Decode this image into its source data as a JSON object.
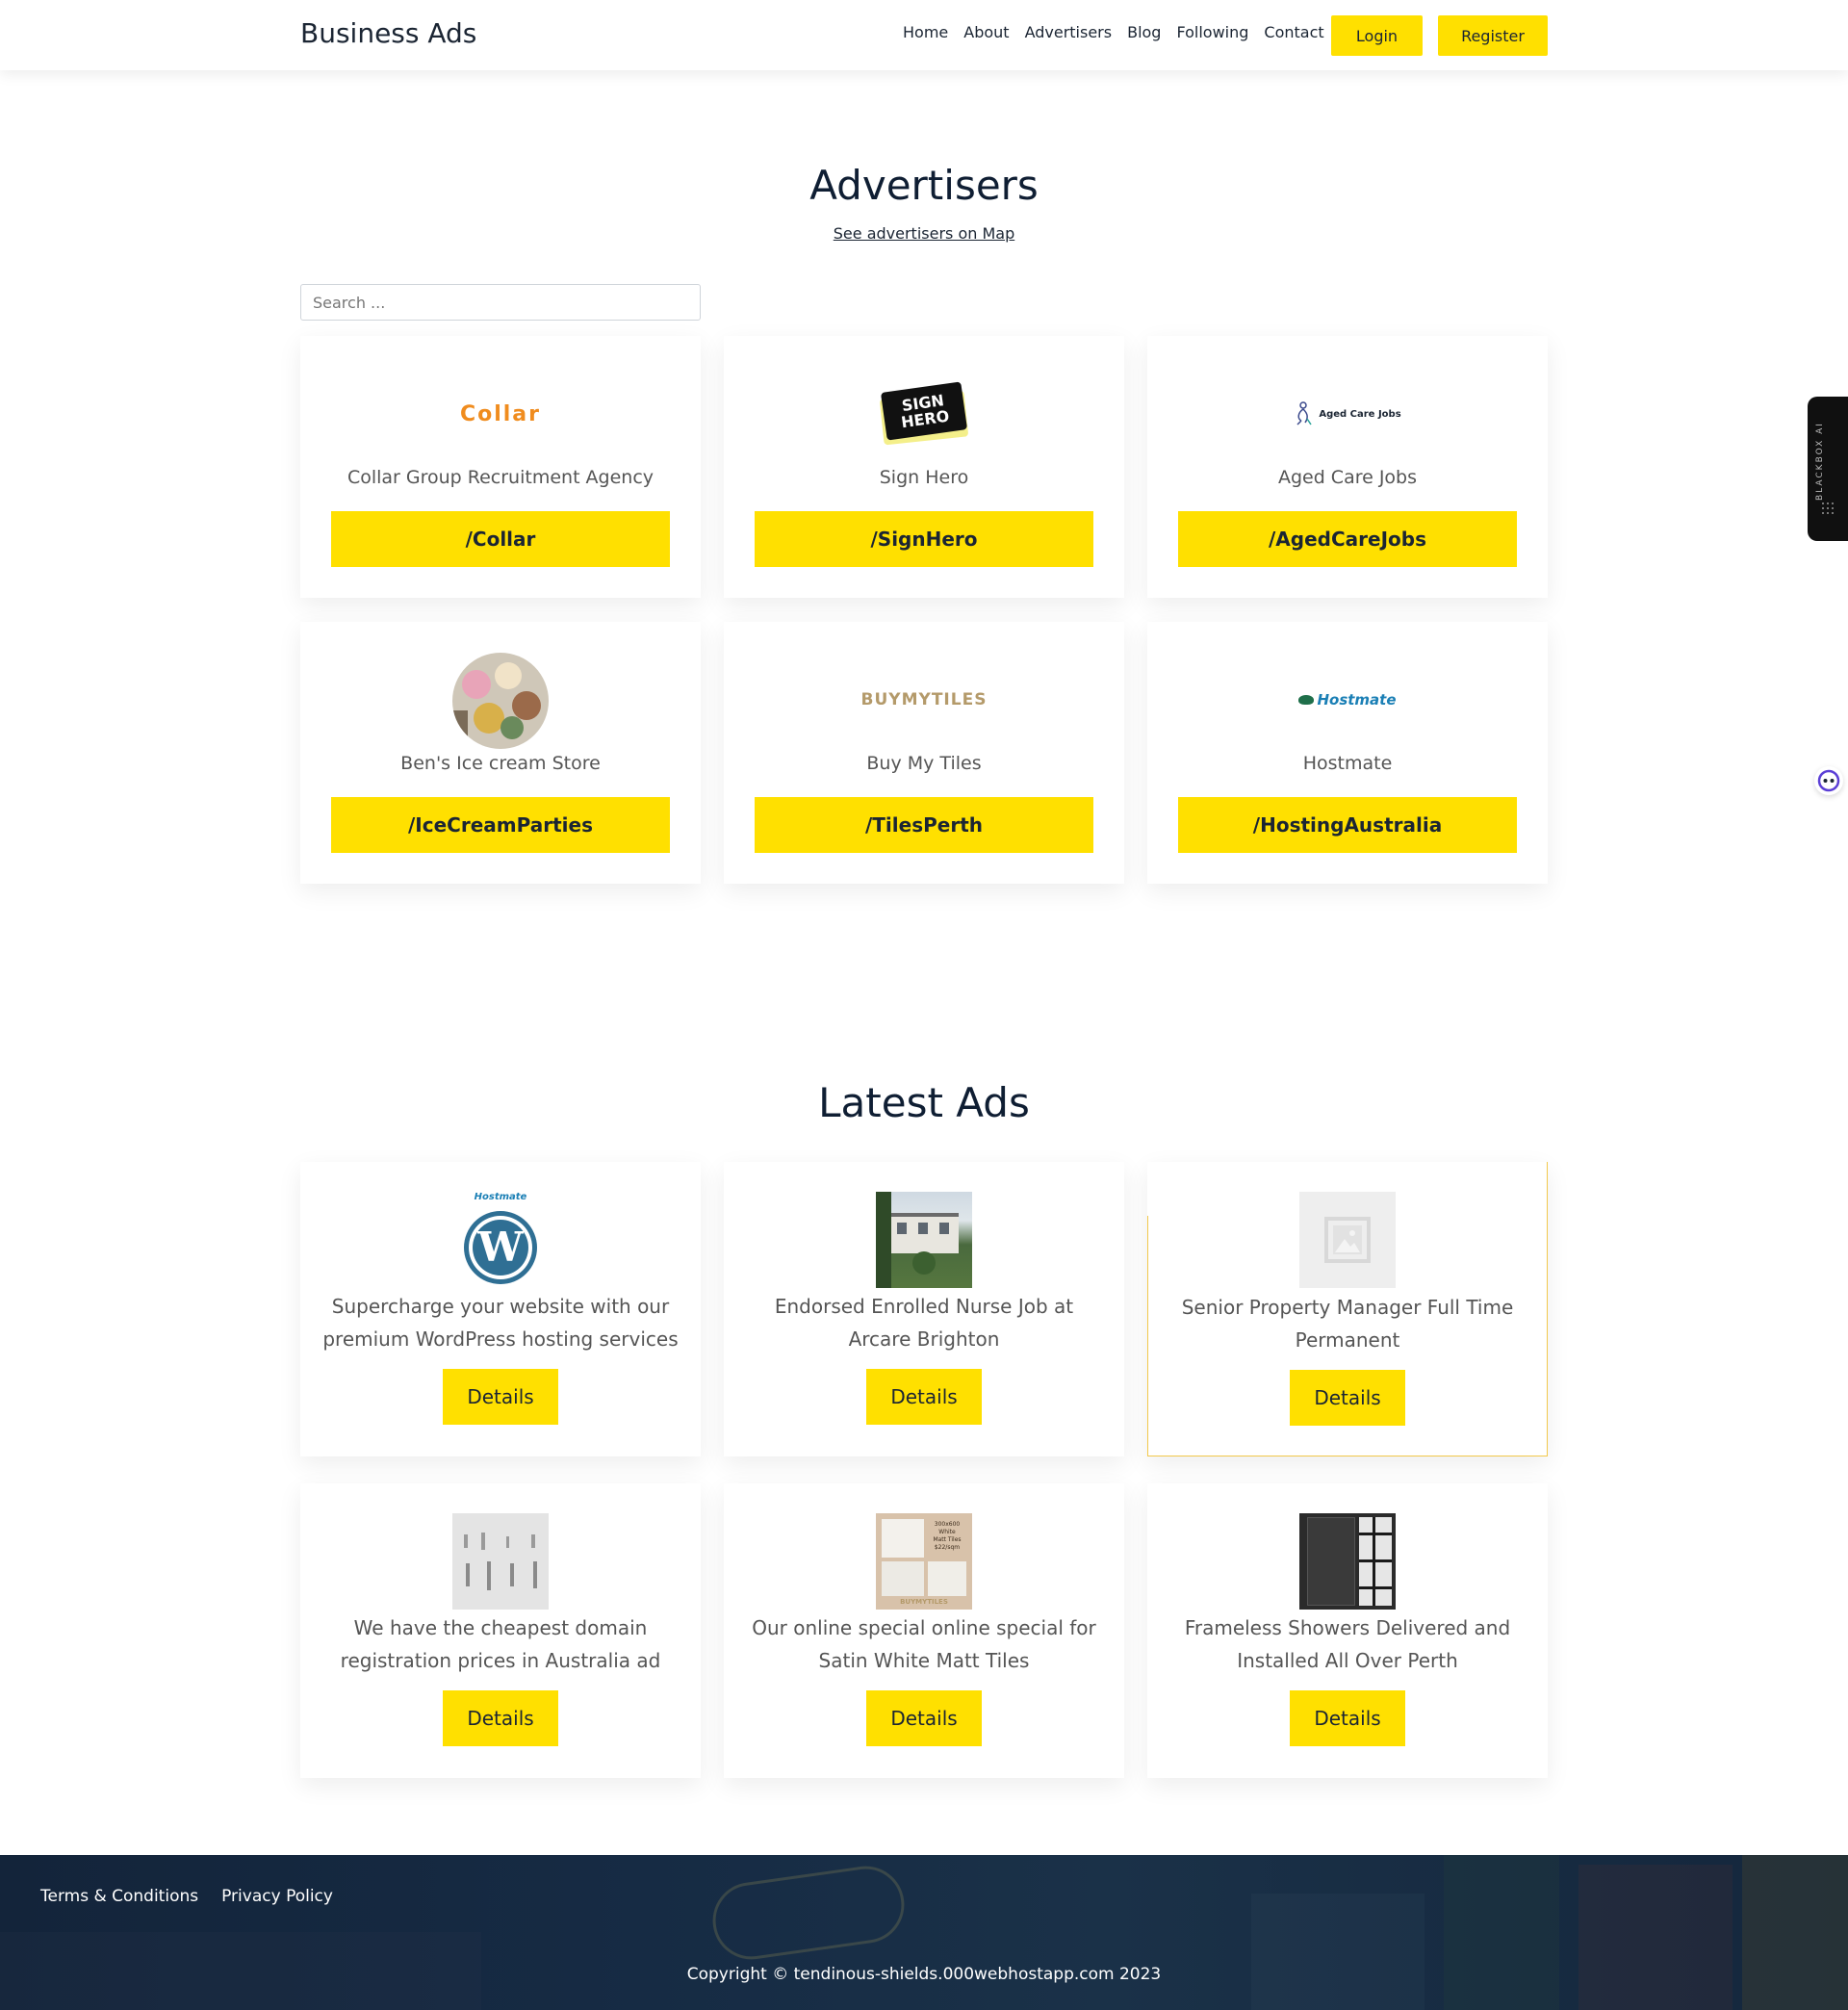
{
  "header": {
    "brand": "Business Ads",
    "nav": [
      "Home",
      "About",
      "Advertisers",
      "Blog",
      "Following",
      "Contact"
    ],
    "login_label": "Login",
    "register_label": "Register"
  },
  "advertisers": {
    "title": "Advertisers",
    "map_link": "See advertisers on Map",
    "search_placeholder": "Search ...",
    "items": [
      {
        "logo_text": "Collar",
        "name": "Collar Group Recruitment Agency",
        "handle": "/Collar"
      },
      {
        "logo_text": "SIGN HERO",
        "name": "Sign Hero",
        "handle": "/SignHero"
      },
      {
        "logo_text": "Aged Care Jobs",
        "name": "Aged Care Jobs",
        "handle": "/AgedCareJobs"
      },
      {
        "logo_text": "",
        "name": "Ben's Ice cream Store",
        "handle": "/IceCreamParties"
      },
      {
        "logo_text": "BUYMYTILES",
        "name": "Buy My Tiles",
        "handle": "/TilesPerth"
      },
      {
        "logo_text": "Hostmate",
        "name": "Hostmate",
        "handle": "/HostingAustralia"
      }
    ]
  },
  "latest_ads": {
    "title": "Latest Ads",
    "details_label": "Details",
    "items": [
      {
        "desc_line1": "Supercharge your website with our",
        "desc_line2": "premium WordPress hosting services",
        "thumb_text": "Hostmate"
      },
      {
        "desc_line1": "Endorsed Enrolled Nurse Job at",
        "desc_line2": "Arcare Brighton",
        "thumb_text": ""
      },
      {
        "desc_line1": "Senior Property Manager Full Time",
        "desc_line2": "Permanent",
        "thumb_text": ""
      },
      {
        "desc_line1": "We have the cheapest domain",
        "desc_line2": "registration prices in Australia ad",
        "thumb_text": ""
      },
      {
        "desc_line1": "Our online special online special for",
        "desc_line2": "Satin White Matt Tiles",
        "thumb_text": "BUYMYTILES"
      },
      {
        "desc_line1": "Frameless Showers Delivered and",
        "desc_line2": "Installed All Over Perth",
        "thumb_text": ""
      }
    ]
  },
  "footer": {
    "links": [
      "Terms & Conditions",
      "Privacy Policy"
    ],
    "copyright": "Copyright © tendinous-shields.000webhostapp.com 2023"
  },
  "side_widget": {
    "label": "BLACKBOX AI"
  },
  "colors": {
    "accent": "#ffe000",
    "heading": "#0f1e33",
    "footer_bg": "#14263c"
  }
}
